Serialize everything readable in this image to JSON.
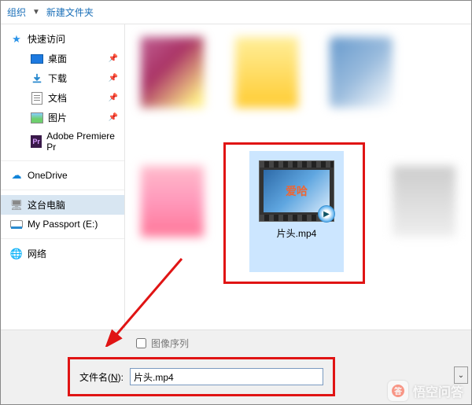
{
  "toolbar": {
    "organize": "组织",
    "new_folder": "新建文件夹"
  },
  "sidebar": {
    "quick_access": "快速访问",
    "desktop": "桌面",
    "downloads": "下载",
    "documents": "文档",
    "pictures": "图片",
    "premiere": "Adobe Premiere Pr",
    "onedrive": "OneDrive",
    "this_pc": "这台电脑",
    "my_passport": "My Passport (E:)",
    "network": "网络"
  },
  "files": {
    "selected_video": "片头.mp4",
    "selected_badge": "爱哈"
  },
  "bottom": {
    "image_sequence": "图像序列",
    "filename_label_prefix": "文件名(",
    "filename_label_key": "N",
    "filename_label_suffix": "):",
    "filename_value": "片头.mp4"
  },
  "watermark": {
    "text": "悟空问答"
  },
  "colors": {
    "annotation": "#e01414",
    "selection_bg": "#cce6ff"
  }
}
